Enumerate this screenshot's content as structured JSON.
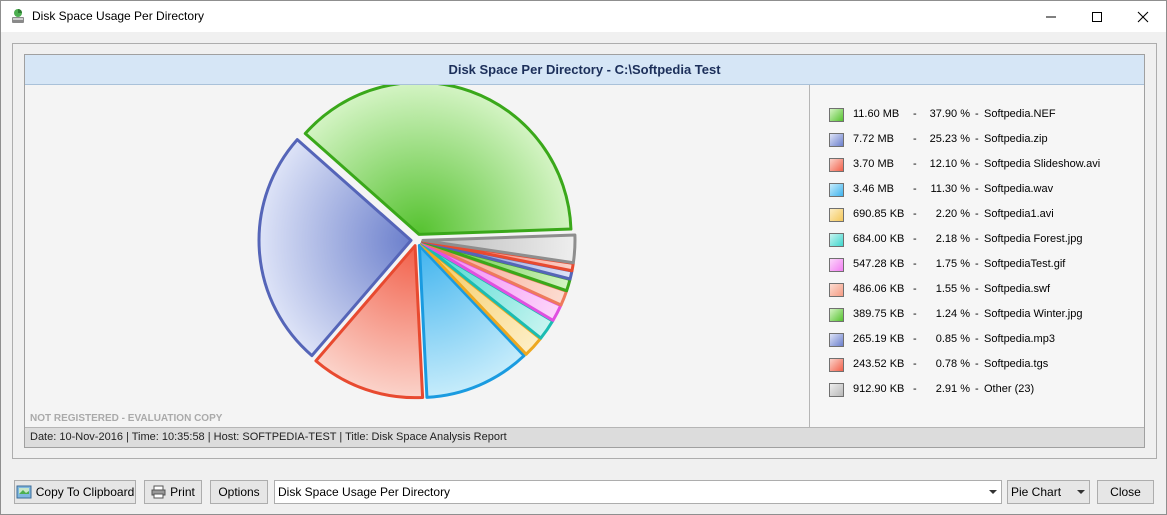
{
  "window": {
    "title": "Disk Space Usage Per Directory",
    "icon": "disk-usage-app-icon"
  },
  "chart_header": "Disk Space Per Directory - C:\\Softpedia Test",
  "watermark": "NOT REGISTERED - EVALUATION COPY",
  "status": "Date: 10-Nov-2016 | Time: 10:35:58 | Host: SOFTPEDIA-TEST | Title: Disk Space Analysis Report",
  "chart_data": {
    "type": "pie",
    "title": "Disk Space Per Directory - C:\\Softpedia Test",
    "slices": [
      {
        "size": "11.60 MB",
        "pct": 37.9,
        "label": "Softpedia.NEF",
        "color": "#55c22f",
        "light": "#d4f4c4",
        "stroke": "#3aa81a"
      },
      {
        "size": "7.72 MB",
        "pct": 25.23,
        "label": "Softpedia.zip",
        "color": "#6b7fcc",
        "light": "#dde3f7",
        "stroke": "#5565b8"
      },
      {
        "size": "3.70 MB",
        "pct": 12.1,
        "label": "Softpedia Slideshow.avi",
        "color": "#f2604a",
        "light": "#fbd3ca",
        "stroke": "#e84a30"
      },
      {
        "size": "3.46 MB",
        "pct": 11.3,
        "label": "Softpedia.wav",
        "color": "#3fb3ee",
        "light": "#c6ecfb",
        "stroke": "#1a9be0"
      },
      {
        "size": "690.85 KB",
        "pct": 2.2,
        "label": "Softpedia1.avi",
        "color": "#f4c75a",
        "light": "#fdeec5",
        "stroke": "#eda820"
      },
      {
        "size": "684.00 KB",
        "pct": 2.18,
        "label": "Softpedia Forest.jpg",
        "color": "#3fd6cd",
        "light": "#c8f4f0",
        "stroke": "#1bbcb2"
      },
      {
        "size": "547.28 KB",
        "pct": 1.75,
        "label": "SoftpediaTest.gif",
        "color": "#f27ef2",
        "light": "#fcd6fb",
        "stroke": "#e050e0"
      },
      {
        "size": "486.06 KB",
        "pct": 1.55,
        "label": "Softpedia.swf",
        "color": "#f59c84",
        "light": "#fcdcd1",
        "stroke": "#ee7a5c"
      },
      {
        "size": "389.75 KB",
        "pct": 1.24,
        "label": "Softpedia Winter.jpg",
        "color": "#55c22f",
        "light": "#d4f4c4",
        "stroke": "#3aa81a"
      },
      {
        "size": "265.19 KB",
        "pct": 0.85,
        "label": "Softpedia.mp3",
        "color": "#6b7fcc",
        "light": "#dde3f7",
        "stroke": "#5565b8"
      },
      {
        "size": "243.52 KB",
        "pct": 0.78,
        "label": "Softpedia.tgs",
        "color": "#f2604a",
        "light": "#fbd3ca",
        "stroke": "#e84a30"
      },
      {
        "size": "912.90 KB",
        "pct": 2.91,
        "label": "Other (23)",
        "color": "#b8b8b8",
        "light": "#eeeeee",
        "stroke": "#8e8e8e"
      }
    ],
    "exploded": [
      0,
      1,
      2,
      3,
      4,
      5,
      6,
      7,
      8,
      9,
      10,
      11
    ],
    "legend_position": "right"
  },
  "toolbar": {
    "copy_label": "Copy To Clipboard",
    "print_label": "Print",
    "options_label": "Options",
    "report_selected": "Disk Space Usage Per Directory",
    "chart_type_selected": "Pie Chart",
    "close_label": "Close"
  }
}
